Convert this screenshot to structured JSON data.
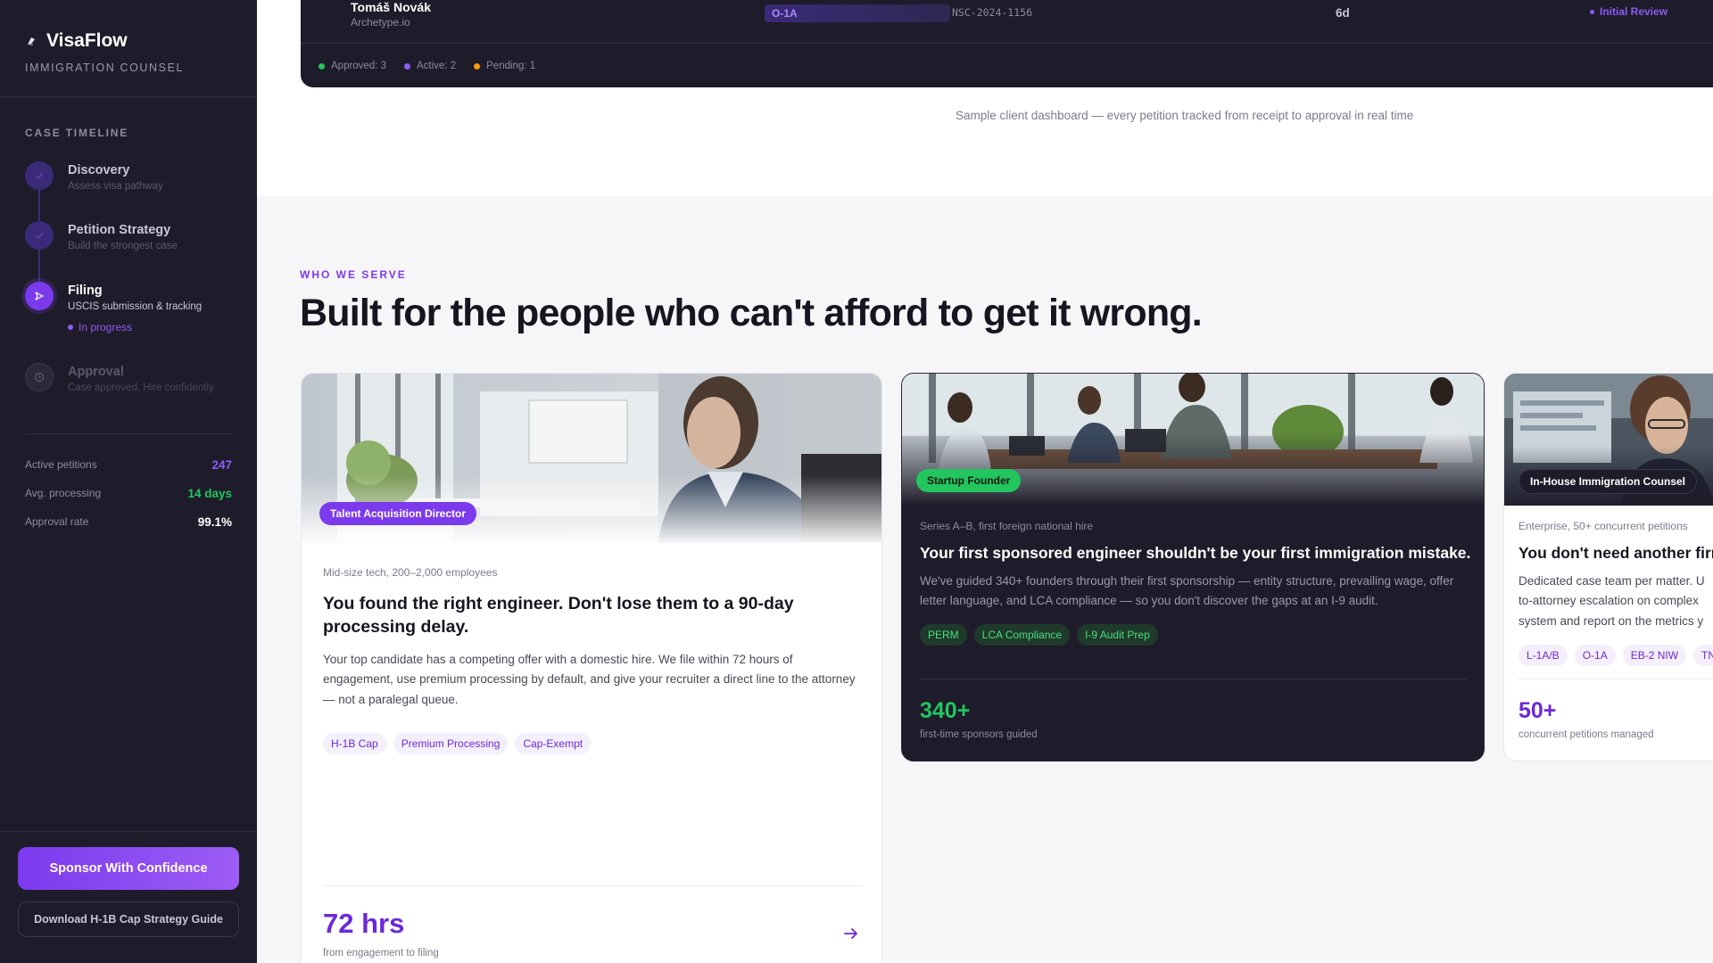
{
  "brand": {
    "name": "VisaFlow",
    "subtitle": "IMMIGRATION COUNSEL"
  },
  "timeline": {
    "heading": "CASE TIMELINE",
    "steps": [
      {
        "title": "Discovery",
        "desc": "Assess visa pathway",
        "state": "done"
      },
      {
        "title": "Petition Strategy",
        "desc": "Build the strongest case",
        "state": "done"
      },
      {
        "title": "Filing",
        "desc": "USCIS submission & tracking",
        "state": "active",
        "status": "In progress"
      },
      {
        "title": "Approval",
        "desc": "Case approved. Hire confidently.",
        "state": "upcoming"
      }
    ]
  },
  "stats": [
    {
      "label": "Active petitions",
      "value": "247",
      "color": "#8b5cf6"
    },
    {
      "label": "Avg. processing",
      "value": "14 days",
      "color": "#22c55e"
    },
    {
      "label": "Approval rate",
      "value": "99.1%",
      "color": "#ffffff"
    }
  ],
  "sidebar_cta": {
    "primary": "Sponsor With Confidence",
    "secondary": "Download H-1B Cap Strategy Guide"
  },
  "dashboard": {
    "row": {
      "name": "Tomáš Novák",
      "company": "Archetype.io",
      "visa": "O-1A",
      "receipt": "NSC-2024-1156",
      "days": "6d",
      "status": "Initial Review"
    },
    "legend": [
      {
        "label": "Approved: 3",
        "color": "#22c55e"
      },
      {
        "label": "Active: 2",
        "color": "#8b5cf6"
      },
      {
        "label": "Pending: 1",
        "color": "#f59e0b"
      }
    ]
  },
  "caption": "Sample client dashboard — every petition tracked from receipt to approval in real time",
  "section": {
    "eyebrow": "WHO WE SERVE",
    "heading": "Built for the people who can't afford to get it wrong."
  },
  "cards": [
    {
      "role": "Talent Acquisition Director",
      "meta": "Mid-size tech, 200–2,000 employees",
      "title": "You found the right engineer. Don't lose them to a 90-day processing delay.",
      "body": "Your top candidate has a competing offer with a domestic hire. We file within 72 hours of engagement, use premium processing by default, and give your recruiter a direct line to the attorney — not a paralegal queue.",
      "tags": [
        "H-1B Cap",
        "Premium Processing",
        "Cap-Exempt"
      ],
      "metric": "72 hrs",
      "metric_label": "from engagement to filing"
    },
    {
      "role": "Startup Founder",
      "meta": "Series A–B, first foreign national hire",
      "title": "Your first sponsored engineer shouldn't be your first immigration mistake.",
      "body": "We've guided 340+ founders through their first sponsorship — entity structure, prevailing wage, offer letter language, and LCA compliance — so you don't discover the gaps at an I-9 audit.",
      "tags": [
        "PERM",
        "LCA Compliance",
        "I-9 Audit Prep"
      ],
      "metric": "340+",
      "metric_label": "first-time sponsors guided"
    },
    {
      "role": "In-House Immigration Counsel",
      "meta": "Enterprise, 50+ concurrent petitions",
      "title": "You don't need another firm",
      "body_lines": [
        "Dedicated case team per matter. U",
        "to-attorney escalation on complex",
        "system and report on the metrics y"
      ],
      "tags": [
        "L-1A/B",
        "O-1A",
        "EB-2 NIW",
        "TN"
      ],
      "metric": "50+",
      "metric_label": "concurrent petitions managed"
    }
  ]
}
